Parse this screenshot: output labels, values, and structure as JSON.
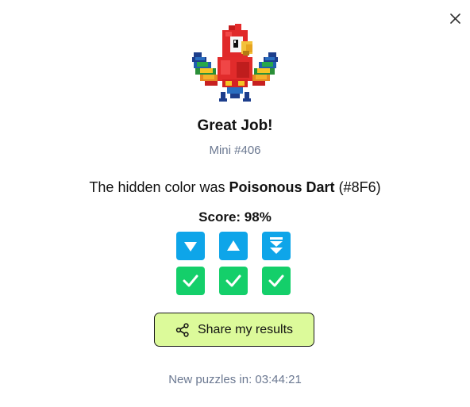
{
  "header": {
    "close_icon": "close-icon",
    "mascot_icon": "parrot-icon"
  },
  "result": {
    "title": "Great Job!",
    "subtitle": "Mini #406",
    "hidden_prefix": "The hidden color was ",
    "color_name": "Poisonous Dart",
    "color_code": "(#8F6)",
    "score_label": "Score: 98%"
  },
  "grid": {
    "rows": [
      [
        "arrow-down-icon",
        "arrow-up-icon",
        "double-arrow-down-icon"
      ],
      [
        "check-icon",
        "check-icon",
        "check-icon"
      ]
    ],
    "hint_color": "#0ea5e9",
    "correct_color": "#14cf6a"
  },
  "share": {
    "label": "Share my results",
    "icon": "share-icon",
    "background": "#dcfa9a"
  },
  "footer": {
    "countdown": "New puzzles in: 03:44:21"
  }
}
